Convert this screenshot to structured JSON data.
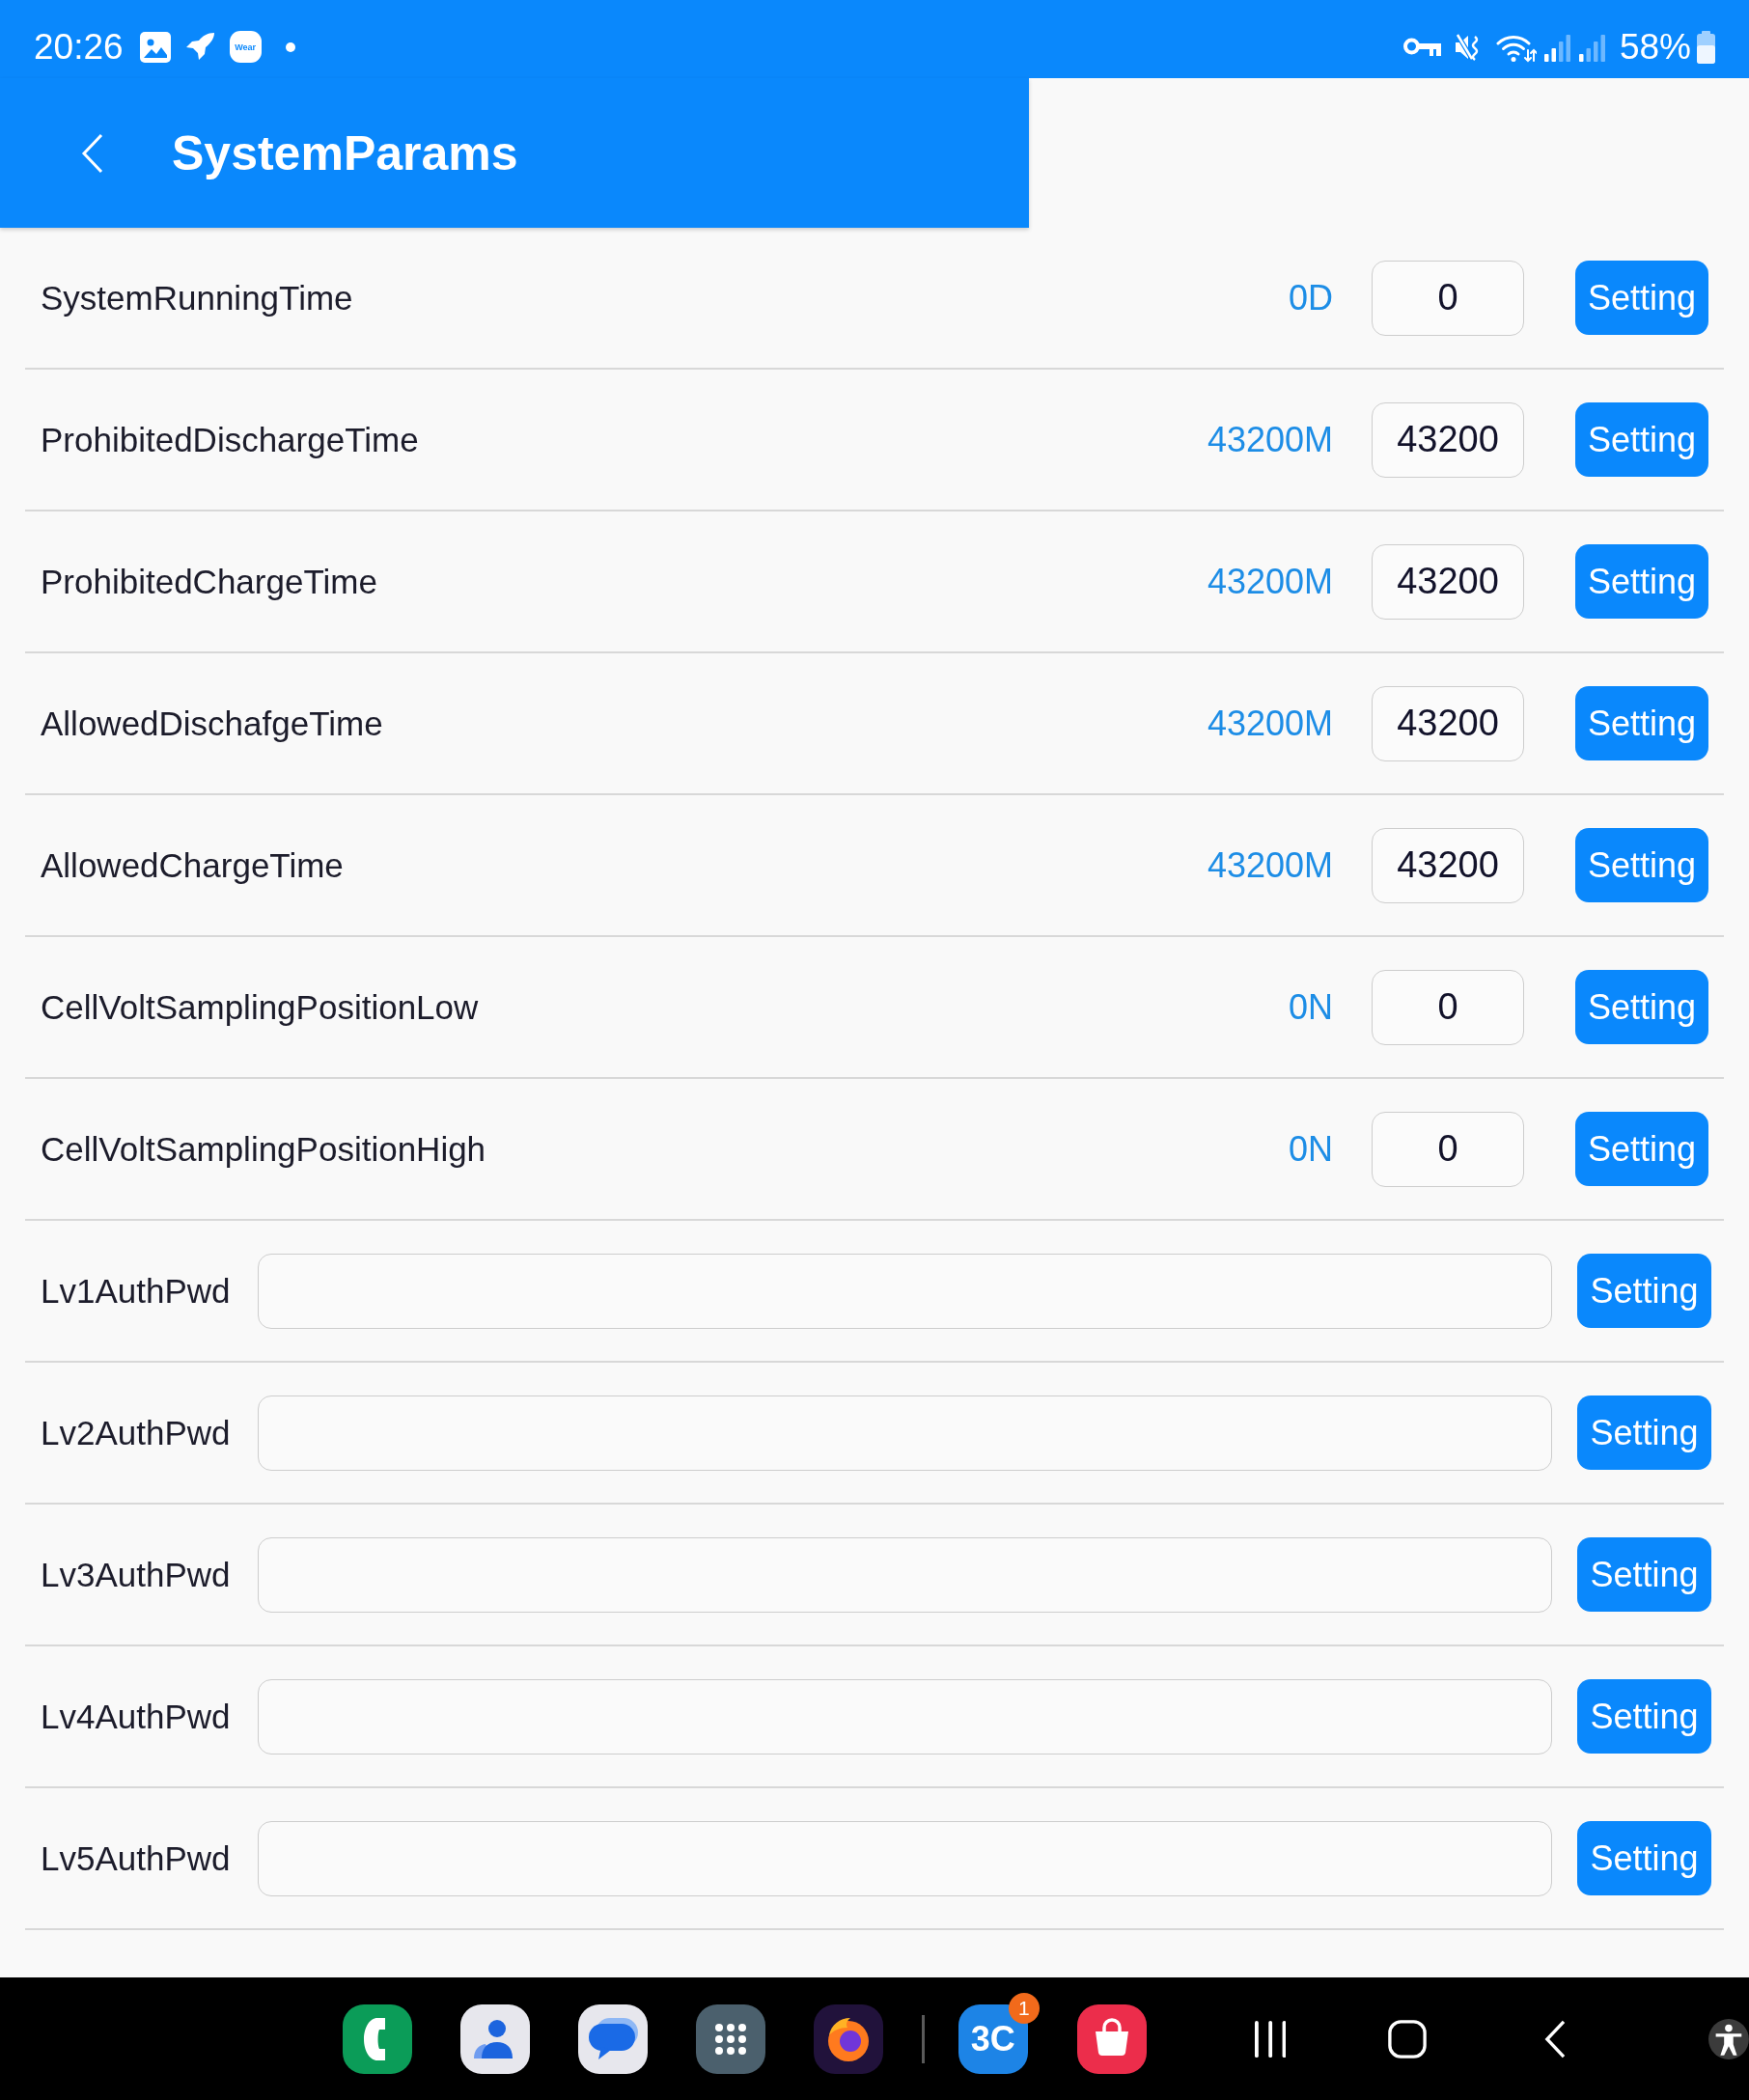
{
  "status_bar": {
    "time": "20:26",
    "notification_icons": [
      {
        "kind": "gallery"
      },
      {
        "kind": "rocket"
      },
      {
        "kind": "wear",
        "label": "Wear"
      },
      {
        "kind": "dot"
      }
    ],
    "battery_percent": "58%"
  },
  "app_bar": {
    "title": "SystemParams"
  },
  "rows": [
    {
      "kind": "number",
      "label": "SystemRunningTime",
      "reading": "0D",
      "value": "0",
      "button": "Setting"
    },
    {
      "kind": "number",
      "label": "ProhibitedDischargeTime",
      "reading": "43200M",
      "value": "43200",
      "button": "Setting"
    },
    {
      "kind": "number",
      "label": "ProhibitedChargeTime",
      "reading": "43200M",
      "value": "43200",
      "button": "Setting"
    },
    {
      "kind": "number",
      "label": "AllowedDischafgeTime",
      "reading": "43200M",
      "value": "43200",
      "button": "Setting"
    },
    {
      "kind": "number",
      "label": "AllowedChargeTime",
      "reading": "43200M",
      "value": "43200",
      "button": "Setting"
    },
    {
      "kind": "number",
      "label": "CellVoltSamplingPositionLow",
      "reading": "0N",
      "value": "0",
      "button": "Setting"
    },
    {
      "kind": "number",
      "label": "CellVoltSamplingPositionHigh",
      "reading": "0N",
      "value": "0",
      "button": "Setting"
    },
    {
      "kind": "password",
      "label": "Lv1AuthPwd",
      "button": "Setting"
    },
    {
      "kind": "password",
      "label": "Lv2AuthPwd",
      "button": "Setting"
    },
    {
      "kind": "password",
      "label": "Lv3AuthPwd",
      "button": "Setting"
    },
    {
      "kind": "password",
      "label": "Lv4AuthPwd",
      "button": "Setting"
    },
    {
      "kind": "password",
      "label": "Lv5AuthPwd",
      "button": "Setting"
    }
  ],
  "dock": {
    "favorites": [
      {
        "kind": "phone"
      },
      {
        "kind": "contacts"
      },
      {
        "kind": "messages"
      },
      {
        "kind": "apps"
      },
      {
        "kind": "firefox"
      }
    ],
    "recent_apps": [
      {
        "kind": "battery",
        "label": "3C",
        "badge": "1"
      },
      {
        "kind": "store"
      }
    ]
  }
}
